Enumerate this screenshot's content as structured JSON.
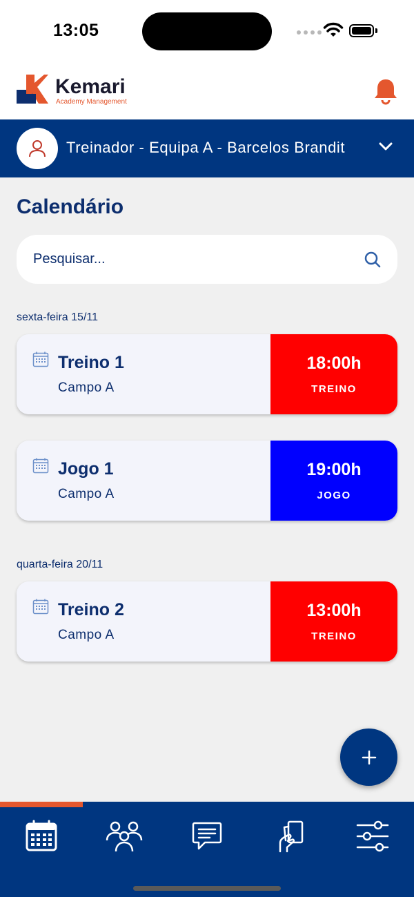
{
  "status_bar": {
    "time": "13:05"
  },
  "app": {
    "logo_name": "Kemari",
    "logo_subtitle": "Academy Management",
    "accent_color": "#e4572e",
    "primary_color": "#003680"
  },
  "team_selector": {
    "label": "Treinador - Equipa A - Barcelos Brandit"
  },
  "page": {
    "title": "Calendário"
  },
  "search": {
    "placeholder": "Pesquisar..."
  },
  "days": [
    {
      "label": "sexta-feira 15/11",
      "events": [
        {
          "title": "Treino 1",
          "place": "Campo A",
          "time": "18:00h",
          "type": "TREINO",
          "color": "#ff0000"
        },
        {
          "title": "Jogo 1",
          "place": "Campo A",
          "time": "19:00h",
          "type": "JOGO",
          "color": "#0000ff"
        }
      ]
    },
    {
      "label": "quarta-feira 20/11",
      "events": [
        {
          "title": "Treino 2",
          "place": "Campo A",
          "time": "13:00h",
          "type": "TREINO",
          "color": "#ff0000"
        }
      ]
    }
  ],
  "bottom_nav": {
    "active_index": 0,
    "items": [
      "calendar-icon",
      "team-icon",
      "chat-icon",
      "cards-icon",
      "settings-sliders-icon"
    ]
  }
}
